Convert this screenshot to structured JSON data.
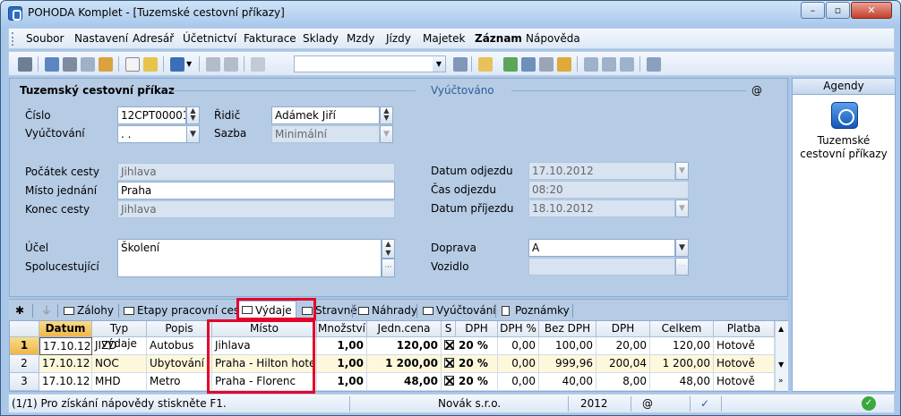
{
  "window": {
    "title": "POHODA Komplet - [Tuzemské cestovní příkazy]"
  },
  "menu": [
    "Soubor",
    "Nastavení",
    "Adresář",
    "Účetnictví",
    "Fakturace",
    "Sklady",
    "Mzdy",
    "Jízdy",
    "Majetek",
    "Záznam",
    "Nápověda"
  ],
  "form": {
    "section_title": "Tuzemský cestovní příkaz",
    "section_right_title": "Vyúčtováno",
    "at_symbol": "@",
    "cislo_label": "Číslo",
    "cislo_value": "12CPT00001",
    "vyuctovani_label": "Vyúčtování",
    "vyuctovani_value": ". .",
    "ridic_label": "Řidič",
    "ridic_value": "Adámek Jiří",
    "sazba_label": "Sazba",
    "sazba_value": "Minimální",
    "pocatek_label": "Počátek cesty",
    "pocatek_value": "Jihlava",
    "misto_label": "Místo jednání",
    "misto_value": "Praha",
    "konec_label": "Konec cesty",
    "konec_value": "Jihlava",
    "ucel_label": "Účel",
    "ucel_value": "Školení",
    "spolu_label": "Spolucestující",
    "datum_odjezdu_label": "Datum odjezdu",
    "datum_odjezdu_value": "17.10.2012",
    "cas_odjezdu_label": "Čas odjezdu",
    "cas_odjezdu_value": "08:20",
    "datum_prijezdu_label": "Datum příjezdu",
    "datum_prijezdu_value": "18.10.2012",
    "doprava_label": "Doprava",
    "doprava_value": "A",
    "vozidlo_label": "Vozidlo"
  },
  "tabs": [
    "Zálohy",
    "Etapy pracovní cesty",
    "Výdaje",
    "Stravné",
    "Náhrady",
    "Vyúčtování",
    "Poznámky"
  ],
  "grid": {
    "headers": [
      "Datum",
      "Typ výdaje",
      "Popis",
      "Místo",
      "Množství",
      "Jedn.cena",
      "S",
      "DPH",
      "DPH %",
      "Bez DPH",
      "DPH",
      "Celkem",
      "Platba"
    ],
    "rows": [
      {
        "num": "1",
        "datum": "17.10.12",
        "typ": "JIZD",
        "popis": "Autobus",
        "misto": "Jihlava",
        "mnozstvi": "1,00",
        "jcena": "120,00",
        "dph": "20 %",
        "dphp": "0,00",
        "bez": "100,00",
        "dphv": "20,00",
        "celkem": "120,00",
        "platba": "Hotově"
      },
      {
        "num": "2",
        "datum": "17.10.12",
        "typ": "NOC",
        "popis": "Ubytování",
        "misto": "Praha - Hilton hotel",
        "mnozstvi": "1,00",
        "jcena": "1 200,00",
        "dph": "20 %",
        "dphp": "0,00",
        "bez": "999,96",
        "dphv": "200,04",
        "celkem": "1 200,00",
        "platba": "Hotově"
      },
      {
        "num": "3",
        "datum": "17.10.12",
        "typ": "MHD",
        "popis": "Metro",
        "misto": "Praha - Florenc",
        "mnozstvi": "1,00",
        "jcena": "48,00",
        "dph": "20 %",
        "dphp": "0,00",
        "bez": "40,00",
        "dphv": "8,00",
        "celkem": "48,00",
        "platba": "Hotově"
      }
    ]
  },
  "status": {
    "help": "(1/1) Pro získání nápovědy stiskněte F1.",
    "company": "Novák  s.r.o.",
    "year": "2012",
    "at": "@"
  },
  "agendy": {
    "header": "Agendy",
    "item": "Tuzemské cestovní příkazy"
  }
}
